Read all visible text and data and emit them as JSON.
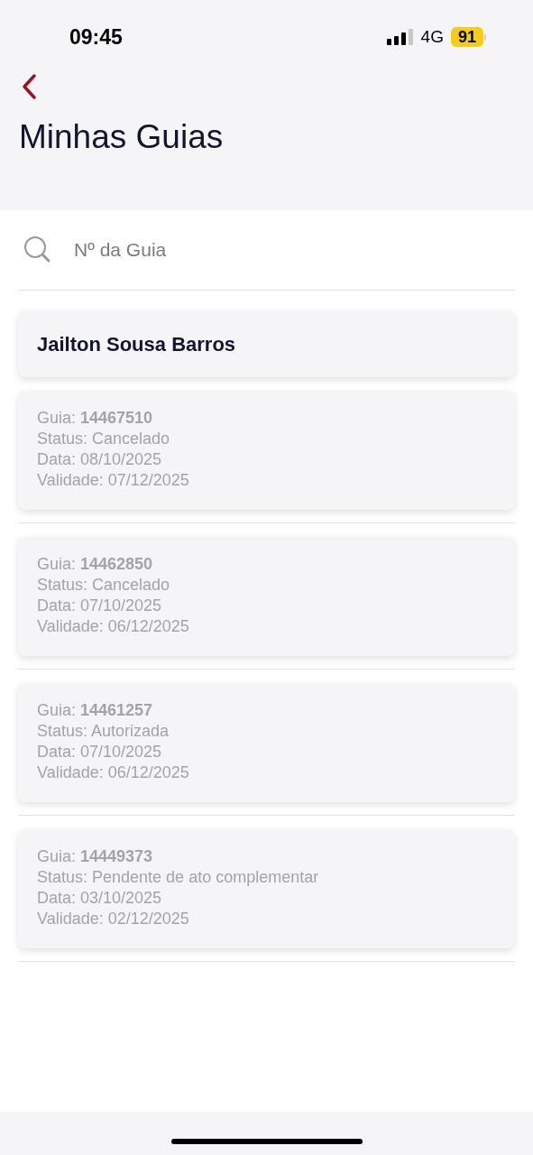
{
  "status_bar": {
    "time": "09:45",
    "network": "4G",
    "battery": "91"
  },
  "header": {
    "title": "Minhas Guias"
  },
  "search": {
    "placeholder": "Nº da Guia"
  },
  "beneficiary": {
    "name": "Jailton Sousa Barros"
  },
  "guides": [
    {
      "lines": [
        "Guia: **14467510**",
        "Status: Cancelado",
        "Data: 08/10/2025",
        "Validade: 07/12/2025"
      ]
    },
    {
      "lines": [
        "Guia: **14462850**",
        "Status: Cancelado",
        "Data: 07/10/2025",
        "Validade: 06/12/2025"
      ]
    },
    {
      "lines": [
        "Guia: **14461257**",
        "Status: Autorizada",
        "Data: 07/10/2025",
        "Validade: 06/12/2025"
      ]
    },
    {
      "lines": [
        "Guia: **14449373**",
        "Status: Pendente de ato complementar",
        "Data: 03/10/2025",
        "Validade: 02/12/2025"
      ]
    }
  ]
}
